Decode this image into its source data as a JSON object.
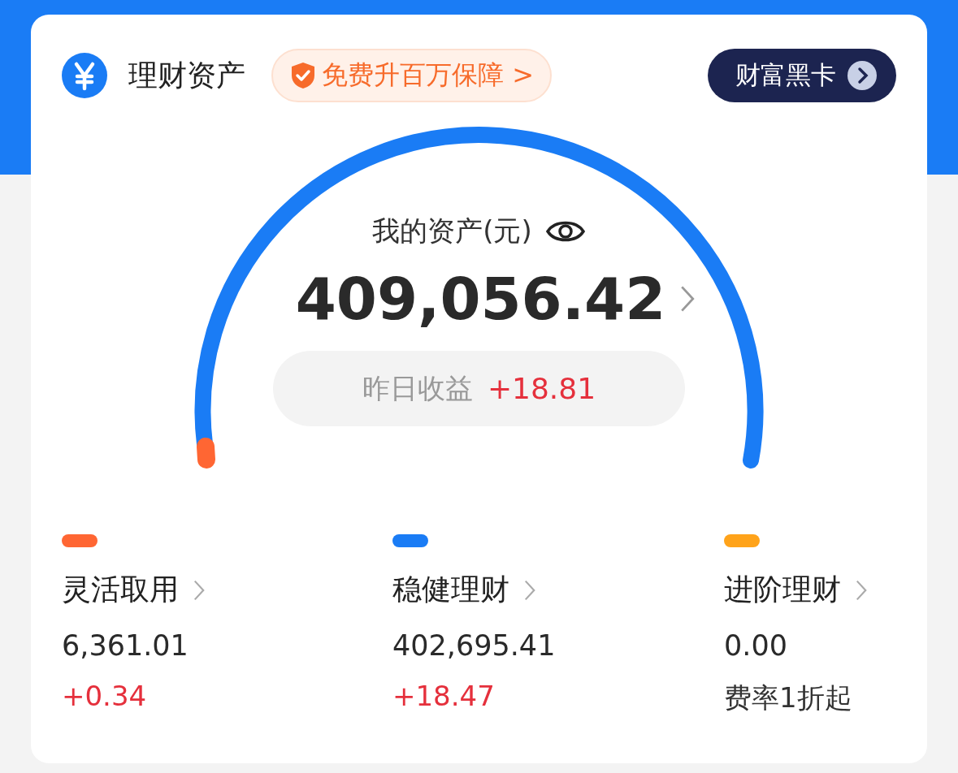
{
  "header": {
    "title": "理财资产",
    "promo": {
      "text": "免费升百万保障",
      "arrow": ">"
    },
    "vip_button": "财富黑卡"
  },
  "assets": {
    "label": "我的资产(元)",
    "amount": "409,056.42",
    "yesterday": {
      "label": "昨日收益",
      "value": "+18.81"
    }
  },
  "categories": [
    {
      "color": "#ff6633",
      "title": "灵活取用",
      "amount": "6,361.01",
      "sub": {
        "text": "+0.34",
        "kind": "gain"
      }
    },
    {
      "color": "#1a7cf5",
      "title": "稳健理财",
      "amount": "402,695.41",
      "sub": {
        "text": "+18.47",
        "kind": "gain"
      }
    },
    {
      "color": "#ffa31a",
      "title": "进阶理财",
      "amount": "0.00",
      "sub": {
        "text": "费率1折起",
        "kind": "note"
      }
    }
  ]
}
